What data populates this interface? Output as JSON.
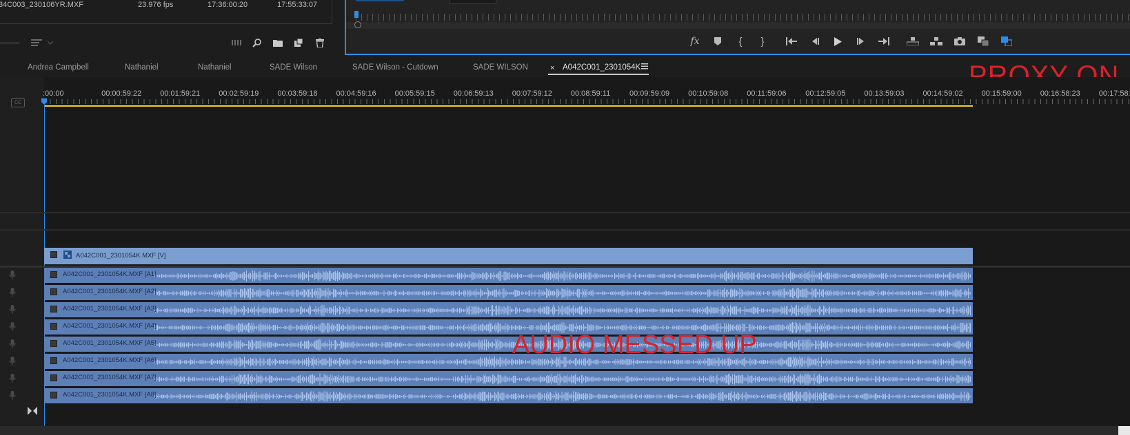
{
  "project": {
    "clip_name": "34C003_230106YR.MXF",
    "fps": "23.976 fps",
    "start_tc": "17:36:00:20",
    "end_tc": "17:55:33:07"
  },
  "tabs": [
    {
      "label": "Andrea Campbell"
    },
    {
      "label": "Nathaniel"
    },
    {
      "label": "Nathaniel"
    },
    {
      "label": "SADE Wilson"
    },
    {
      "label": "SADE Wilson - Cutdown"
    },
    {
      "label": "SADE WILSON"
    },
    {
      "label": "A042C001_2301054K",
      "active": true
    }
  ],
  "ruler": [
    ":00:00",
    "00:00:59:22",
    "00:01:59:21",
    "00:02:59:19",
    "00:03:59:18",
    "00:04:59:16",
    "00:05:59:15",
    "00:06:59:13",
    "00:07:59:12",
    "00:08:59:11",
    "00:09:59:09",
    "00:10:59:08",
    "00:11:59:06",
    "00:12:59:05",
    "00:13:59:03",
    "00:14:59:02",
    "00:15:59:00",
    "00:16:58:23",
    "00:17:58:22"
  ],
  "video_clip": {
    "label": "A042C001_2301054K.MXF [V]"
  },
  "audio_clips": [
    {
      "label": "A042C001_2301054K.MXF [A1]"
    },
    {
      "label": "A042C001_2301054K.MXF [A2]"
    },
    {
      "label": "A042C001_2301054K.MXF [A3]"
    },
    {
      "label": "A042C001_2301054K.MXF [A4]"
    },
    {
      "label": "A042C001_2301054K.MXF [A5]"
    },
    {
      "label": "A042C001_2301054K.MXF [A6]"
    },
    {
      "label": "A042C001_2301054K.MXF [A7]"
    },
    {
      "label": "A042C001_2301054K.MXF [A8]"
    }
  ],
  "annotations": {
    "proxy": "PROXY ON",
    "audio": "AUDIO MESSED UP"
  },
  "colors": {
    "accent": "#2d8ceb",
    "annotation": "#d8222a",
    "audio_clip": "#5d7fb7",
    "video_clip": "#7b9ed0",
    "work_area": "#f4d225"
  }
}
